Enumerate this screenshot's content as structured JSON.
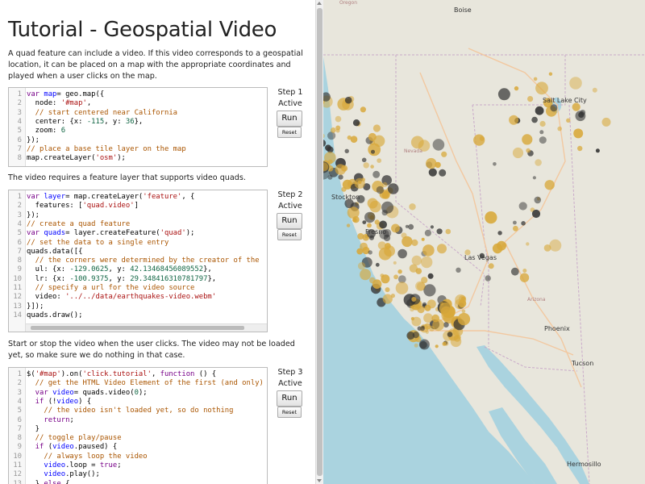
{
  "page": {
    "title": "Tutorial - Geospatial Video",
    "intro": "A quad feature can include a video. If this video corresponds to a geospatial location, it can be placed on a map with the appropriate coordinates and played when a user clicks on the map.",
    "para2": "The video requires a feature layer that supports video quads.",
    "para3": "Start or stop the video when the user clicks. The video may not be loaded yet, so make sure we do nothing in that case."
  },
  "steps": [
    {
      "label": "Step 1",
      "status": "Active",
      "run": "Run",
      "reset": "Reset"
    },
    {
      "label": "Step 2",
      "status": "Active",
      "run": "Run",
      "reset": "Reset"
    },
    {
      "label": "Step 3",
      "status": "Active",
      "run": "Run",
      "reset": "Reset"
    }
  ],
  "code1": [
    [
      [
        "kw",
        "var "
      ],
      [
        "var",
        "map"
      ],
      [
        "",
        "= geo.map({"
      ]
    ],
    [
      [
        "",
        "  node: "
      ],
      [
        "str",
        "'#map'"
      ],
      [
        "",
        ","
      ]
    ],
    [
      [
        "com",
        "  // start centered near California"
      ]
    ],
    [
      [
        "",
        "  center: {x: "
      ],
      [
        "num",
        "-115"
      ],
      [
        "",
        ", y: "
      ],
      [
        "num",
        "36"
      ],
      [
        "",
        "},"
      ]
    ],
    [
      [
        "",
        "  zoom: "
      ],
      [
        "num",
        "6"
      ]
    ],
    [
      [
        "",
        "});"
      ]
    ],
    [
      [
        "com",
        "// place a base tile layer on the map"
      ]
    ],
    [
      [
        "",
        "map.createLayer("
      ],
      [
        "str",
        "'osm'"
      ],
      [
        "",
        ");"
      ]
    ]
  ],
  "code2": [
    [
      [
        "kw",
        "var "
      ],
      [
        "var",
        "layer"
      ],
      [
        "",
        "= map.createLayer("
      ],
      [
        "str",
        "'feature'"
      ],
      [
        "",
        ", {"
      ]
    ],
    [
      [
        "",
        "  features: ["
      ],
      [
        "str",
        "'quad.video'"
      ],
      [
        "",
        "]"
      ]
    ],
    [
      [
        "",
        "});"
      ]
    ],
    [
      [
        "com",
        "// create a quad feature"
      ]
    ],
    [
      [
        "kw",
        "var "
      ],
      [
        "var",
        "quads"
      ],
      [
        "",
        "= layer.createFeature("
      ],
      [
        "str",
        "'quad'"
      ],
      [
        "",
        ");"
      ]
    ],
    [
      [
        "com",
        "// set the data to a single entry"
      ]
    ],
    [
      [
        "",
        "quads.data([{"
      ]
    ],
    [
      [
        "com",
        "  // the corners were determined by the creator of the"
      ]
    ],
    [
      [
        "",
        "  ul: {x: "
      ],
      [
        "num",
        "-129.0625"
      ],
      [
        "",
        ", y: "
      ],
      [
        "num",
        "42.13468456089552"
      ],
      [
        "",
        "},"
      ]
    ],
    [
      [
        "",
        "  lr: {x: "
      ],
      [
        "num",
        "-100.9375"
      ],
      [
        "",
        ", y: "
      ],
      [
        "num",
        "29.348416310781797"
      ],
      [
        "",
        "},"
      ]
    ],
    [
      [
        "com",
        "  // specify a url for the video source"
      ]
    ],
    [
      [
        "",
        "  video: "
      ],
      [
        "str",
        "'../../data/earthquakes-video.webm'"
      ]
    ],
    [
      [
        "",
        "}]);"
      ]
    ],
    [
      [
        "",
        "quads.draw();"
      ]
    ]
  ],
  "code3": [
    [
      [
        "",
        "$("
      ],
      [
        "str",
        "'#map'"
      ],
      [
        "",
        ").on("
      ],
      [
        "str",
        "'click.tutorial'"
      ],
      [
        "",
        ", "
      ],
      [
        "kw",
        "function"
      ],
      [
        "",
        " () {"
      ]
    ],
    [
      [
        "com",
        "  // get the HTML Video Element of the first (and only)"
      ]
    ],
    [
      [
        "kw",
        "  var "
      ],
      [
        "var",
        "video"
      ],
      [
        "",
        "= quads.video("
      ],
      [
        "num",
        "0"
      ],
      [
        "",
        ");"
      ]
    ],
    [
      [
        "kw",
        "  if "
      ],
      [
        "",
        "(!"
      ],
      [
        "var",
        "video"
      ],
      [
        "",
        ") {"
      ]
    ],
    [
      [
        "com",
        "    // the video isn't loaded yet, so do nothing"
      ]
    ],
    [
      [
        "kw",
        "    return"
      ],
      [
        "",
        ";"
      ]
    ],
    [
      [
        "",
        "  }"
      ]
    ],
    [
      [
        "com",
        "  // toggle play/pause"
      ]
    ],
    [
      [
        "kw",
        "  if "
      ],
      [
        "",
        "("
      ],
      [
        "var",
        "video"
      ],
      [
        "",
        ".paused) {"
      ]
    ],
    [
      [
        "com",
        "    // always loop the video"
      ]
    ],
    [
      [
        "var",
        "    video"
      ],
      [
        "",
        ".loop = "
      ],
      [
        "kw",
        "true"
      ],
      [
        "",
        ";"
      ]
    ],
    [
      [
        "var",
        "    video"
      ],
      [
        "",
        ".play();"
      ]
    ],
    [
      [
        "",
        "  } "
      ],
      [
        "kw",
        "else"
      ],
      [
        "",
        " {"
      ]
    ]
  ],
  "map": {
    "cities": [
      "Boise",
      "Salt Lake City",
      "Las Vegas",
      "Phoenix",
      "Tucson",
      "Hermosillo",
      "Fresno",
      "Stockton"
    ],
    "states": [
      "Oregon",
      "Nevada",
      "Arizona"
    ],
    "colors": {
      "land": "#e8e6dc",
      "ocean": "#aad3df",
      "marker": "#d8a83a",
      "dark": "#333333"
    }
  }
}
